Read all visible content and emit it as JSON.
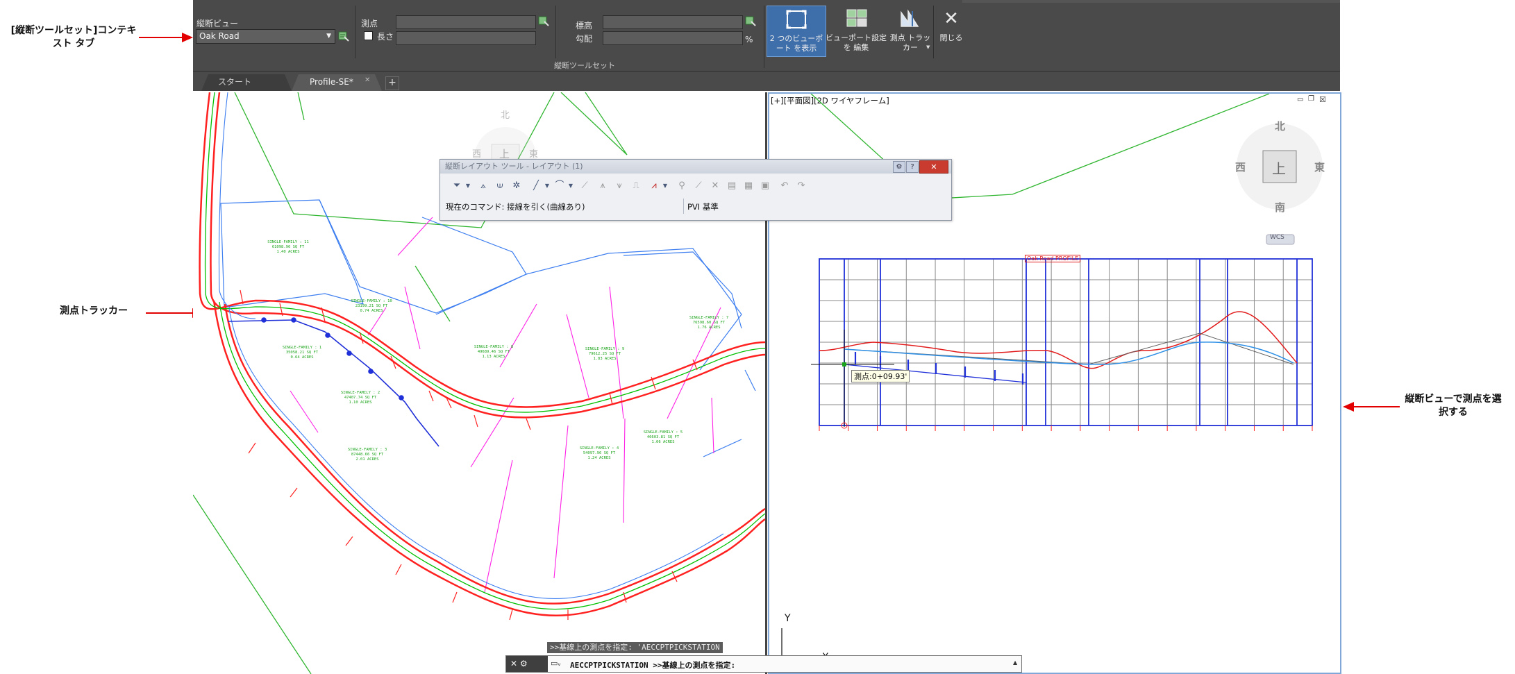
{
  "annotations": {
    "left_top": "[縦断ツールセット]コンテキスト タブ",
    "left_middle": "測点トラッカー",
    "right": "縦断ビューで測点を選択する",
    "arrow_color": "#e20000"
  },
  "ribbon": {
    "profile_view_label": "縦断ビュー",
    "profile_view_value": "Oak Road",
    "station_label": "測点",
    "length_label": "長さ",
    "elevation_label": "標高",
    "grade_label": "勾配",
    "grade_unit": "%",
    "panel_title": "縦断ツールセット",
    "show_two_viewports_label": "2 つのビューポート を表示",
    "edit_viewport_settings_label": "ビューポート設定を 編集",
    "station_tracker_label": "測点 トラッカー",
    "close_label": "閉じる"
  },
  "tabs": [
    {
      "label": "スタート"
    },
    {
      "label": "Profile-SE*"
    }
  ],
  "left_viewport": {
    "compass": {
      "north": "北",
      "west": "西",
      "east": "東",
      "top": "上"
    },
    "lots": [
      {
        "name": "SINGLE-FAMILY : 11",
        "area": "61098.96 SQ FT",
        "acres": "1.40 ACRES"
      },
      {
        "name": "SINGLE-FAMILY : 10",
        "area": "23199.21 SQ FT",
        "acres": "0.74 ACRES"
      },
      {
        "name": "SINGLE-FAMILY : 7",
        "area": "76598.60 SQ FT",
        "acres": "1.76 ACRES"
      },
      {
        "name": "SINGLE-FAMILY : 1",
        "area": "35058.21 SQ FT",
        "acres": "0.64 ACRES"
      },
      {
        "name": "SINGLE-FAMILY : 8",
        "area": "49689.46 SQ FT",
        "acres": "1.13 ACRES"
      },
      {
        "name": "SINGLE-FAMILY : 9",
        "area": "79612.25 SQ FT",
        "acres": "1.83 ACRES"
      },
      {
        "name": "SINGLE-FAMILY : 2",
        "area": "47407.74 SQ FT",
        "acres": "1.10 ACRES"
      },
      {
        "name": "SINGLE-FAMILY : 5",
        "area": "46603.81 SQ FT",
        "acres": "1.06 ACRES"
      },
      {
        "name": "SINGLE-FAMILY : 3",
        "area": "87448.66 SQ FT",
        "acres": "2.01 ACRES"
      },
      {
        "name": "SINGLE-FAMILY : 4",
        "area": "54097.96 SQ FT",
        "acres": "1.24 ACRES"
      }
    ]
  },
  "layout_tools": {
    "title": "縦断レイアウト ツール - レイアウト (1)",
    "current_command": "現在のコマンド: 接線を引く(曲線あり)",
    "pvi_basis": "PVI 基準"
  },
  "right_viewport": {
    "viewport_label": "[+][平面図][2D ワイヤフレーム]",
    "compass": {
      "north": "北",
      "west": "西",
      "east": "東",
      "top": "上",
      "south": "南",
      "wcs": "WCS"
    },
    "profile_title": "Oak Road PROFILE",
    "station_tooltip": "測点:0+09.93'",
    "y_axis_label": "Y",
    "x_axis_label": "X"
  },
  "command_line": {
    "history": ">>基線上の測点を指定: 'AECCPTPICKSTATION",
    "prompt": "AECCPTPICKSTATION >>基線上の測点を指定:"
  }
}
